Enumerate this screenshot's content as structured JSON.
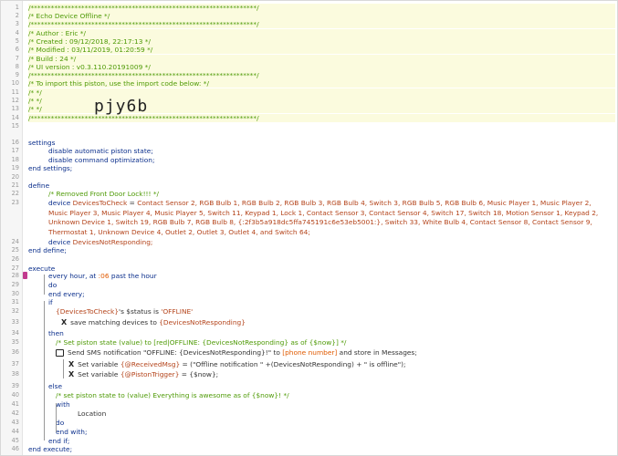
{
  "lines": [
    {
      "n": "1"
    },
    {
      "n": "2"
    },
    {
      "n": "3"
    },
    {
      "n": "4"
    },
    {
      "n": "5"
    },
    {
      "n": "6"
    },
    {
      "n": "7"
    },
    {
      "n": "8"
    },
    {
      "n": "9"
    },
    {
      "n": "10"
    },
    {
      "n": "11"
    },
    {
      "n": "12"
    },
    {
      "n": "13"
    },
    {
      "n": "14"
    },
    {
      "n": "15"
    },
    {
      "n": "16"
    },
    {
      "n": "17"
    },
    {
      "n": "18"
    },
    {
      "n": "19"
    },
    {
      "n": "20"
    },
    {
      "n": "21"
    },
    {
      "n": "22"
    },
    {
      "n": "23"
    },
    {
      "n": "24"
    },
    {
      "n": "25"
    },
    {
      "n": "26"
    },
    {
      "n": "27"
    },
    {
      "n": "28"
    },
    {
      "n": "29"
    },
    {
      "n": "30"
    },
    {
      "n": "31"
    },
    {
      "n": "32"
    },
    {
      "n": "33"
    },
    {
      "n": "34"
    },
    {
      "n": "35"
    },
    {
      "n": "36"
    },
    {
      "n": "37"
    },
    {
      "n": "38"
    },
    {
      "n": "39"
    },
    {
      "n": "40"
    },
    {
      "n": "41"
    },
    {
      "n": "42"
    },
    {
      "n": "43"
    },
    {
      "n": "44"
    },
    {
      "n": "45"
    },
    {
      "n": "46"
    }
  ],
  "header": {
    "stars": "/*******************************************************************/",
    "title": "/* Echo Device Offline                                              */",
    "author": "/* Author        : Eric                                             */",
    "created": "/* Created       : 09/12/2018, 22:17:13                             */",
    "modified": "/* Modified      : 03/11/2019, 01:20:59                             */",
    "build": "/* Build         : 24                                               */",
    "ui_version": "/* UI version    : v0.3.110.20191009                                */",
    "import": "/* To import this piston, use the import code below:                */",
    "blank": "/*                                                                 */",
    "import_code": "pjy6b"
  },
  "settings": {
    "open": "settings",
    "line1": "disable automatic piston state;",
    "line2": "disable command optimization;",
    "close": "end settings;"
  },
  "define": {
    "open": "define",
    "comment": "/* Removed Front Door Lock!!! */",
    "device_kw": "device",
    "var_name": "DevicesToCheck",
    "equals": " = ",
    "devices": "Contact Sensor 2, RGB Bulb 1, RGB Bulb 2, RGB Bulb 3, RGB Bulb 4, Switch 3, RGB Bulb 5, RGB Bulb 6, Music Player 1, Music Player 2, Music Player 3, Music Player 4, Music Player 5, Switch 11, Keypad 1, Lock 1, Contact Sensor 3, Contact Sensor 4, Switch 17, Switch 18, Motion Sensor 1, Keypad 2, Unknown Device 1, Switch 19, RGB Bulb 7, RGB Bulb 8, {:2f3b5a918dc5ffa745191c6e53eb5001:}, Switch 33, White Bulb 4, Contact Sensor 8, Contact Sensor 9, Thermostat 1, Unknown Device 4, Outlet 2, Outlet 3, Outlet 4, and Switch 64;",
    "device2_kw": "device",
    "var2_name": "DevicesNotResponding;",
    "close": "end define;"
  },
  "execute": {
    "open": "execute",
    "every_kw": "every",
    "every_hour": " hour",
    "every_at": ", at ",
    "every_time": ":06",
    "every_rest": " past the hour",
    "do": "do",
    "end_every": "end every;",
    "if": "if",
    "cond_var": "{DevicesToCheck}",
    "cond_attr": "'s $status is ",
    "cond_value": "'OFFLINE'",
    "save_icon": "X",
    "save_text": "save matching devices to ",
    "save_var": "{DevicesNotResponding}",
    "then": "then",
    "then_comment": "/* Set piston state (value) to [red|OFFLINE: {DevicesNotResponding} as of {$now}] */",
    "sms_text": "Send SMS notification \"OFFLINE: {DevicesNotResponding}!\" to ",
    "sms_phone": "[phone number]",
    "sms_rest": " and store in Messages;",
    "setvar1_kw": "Set variable ",
    "setvar1_name": "{@ReceivedMsg}",
    "setvar1_val": " = (\"Offline notification \" +(DevicesNotResponding) + \" is offline\");",
    "setvar2_kw": "Set variable ",
    "setvar2_name": "{@PistonTrigger}",
    "setvar2_val": " = {$now};",
    "else": "else",
    "else_comment": "/* set piston state to (value) Everything is awesome as of {$now}! */",
    "with": "with",
    "location": "Location",
    "with_do": "do",
    "end_with": "end with;",
    "end_if": "end if;",
    "close": "end execute;"
  },
  "colors": {
    "comment": "#4e9a06",
    "keyword": "#0b2f8c",
    "device": "#b4441b",
    "literal": "#e05a00",
    "highlight": "#fbfbde"
  }
}
